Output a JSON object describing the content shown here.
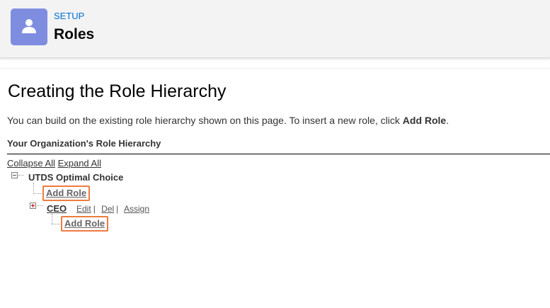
{
  "header": {
    "eyebrow": "SETUP",
    "title": "Roles",
    "icon": "user-icon",
    "icon_bg": "#7f8de1",
    "eyebrow_color": "#0070d2"
  },
  "main": {
    "heading": "Creating the Role Hierarchy",
    "intro_text": "You can build on the existing role hierarchy shown on this page. To insert a new role, click ",
    "intro_bold": "Add Role",
    "intro_end": ".",
    "section_title": "Your Organization's Role Hierarchy"
  },
  "tree": {
    "collapse_all": "Collapse All",
    "expand_all": "Expand All",
    "root": {
      "label": "UTDS Optimal Choice",
      "toggle": "collapse-icon",
      "add_role": "Add Role"
    },
    "child": {
      "label": "CEO",
      "toggle": "expand-icon",
      "edit": "Edit",
      "del": "Del",
      "assign": "Assign",
      "separator": "|",
      "add_role": "Add Role"
    },
    "highlight_color": "#f07b3f"
  }
}
